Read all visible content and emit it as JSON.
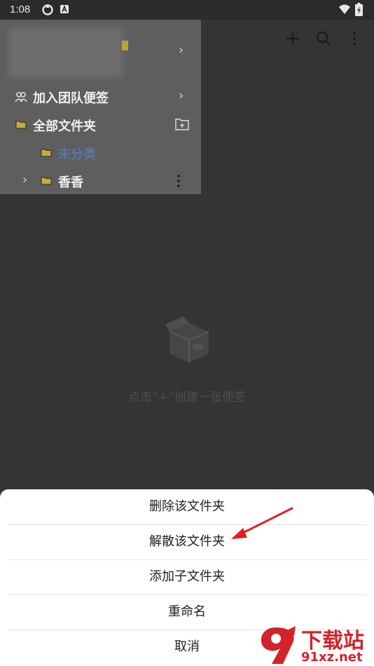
{
  "status_bar": {
    "time": "1:08",
    "icons": [
      "sync-icon",
      "a-badge-icon",
      "wifi-icon",
      "battery-charging-icon"
    ]
  },
  "toolbar": {
    "add_icon": "plus-icon",
    "search_icon": "search-icon",
    "more_icon": "more-vertical-icon"
  },
  "drawer": {
    "items": [
      {
        "label": "加入团队便签",
        "icon": "team-icon"
      },
      {
        "label": "全部文件夹",
        "icon": "folder-icon",
        "action_icon": "new-folder-icon"
      },
      {
        "label": "未分类",
        "icon": "folder-icon",
        "selected": true
      },
      {
        "label": "香香",
        "icon": "folder-icon",
        "expand_icon": "chevron-right-icon",
        "more_icon": "more-vertical-icon"
      }
    ]
  },
  "empty_state": {
    "hint": "点击“+”创建一张便签"
  },
  "sheet": {
    "items": [
      {
        "label": "删除该文件夹"
      },
      {
        "label": "解散该文件夹"
      },
      {
        "label": "添加子文件夹"
      },
      {
        "label": "重命名"
      },
      {
        "label": "取消"
      }
    ]
  },
  "watermark": {
    "text_top": "下载站",
    "text_bottom": "91xz.net"
  },
  "colors": {
    "accent_selected": "#5a76a8",
    "folder_yellow": "#c9a93a",
    "arrow_red": "#e02020",
    "watermark_red": "#d3232a"
  }
}
